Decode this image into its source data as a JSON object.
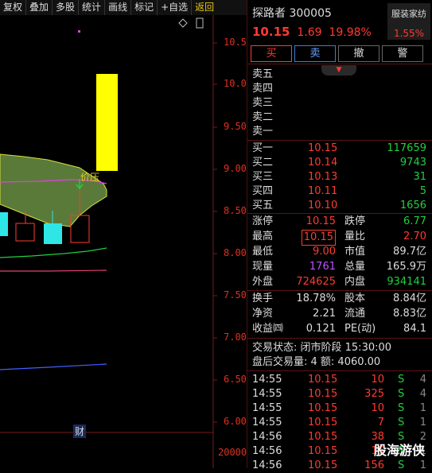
{
  "toolbar": {
    "items": [
      "复权",
      "叠加",
      "多股",
      "统计",
      "画线",
      "标记",
      "+自选",
      "返回"
    ]
  },
  "chart": {
    "price_ticks": [
      "10.50",
      "10.00",
      "9.50",
      "9.00",
      "8.50",
      "8.00",
      "7.50",
      "7.00",
      "6.50",
      "6.00"
    ],
    "volume_tick": "20000",
    "annotation_pressure": "价压",
    "annotation_finance": "财",
    "colors": {
      "up": "#ff3b30",
      "down": "#2ee6e6",
      "yellow": "#ffff00",
      "cloud": "#5a7a3a"
    }
  },
  "quote": {
    "name_code": "探路者 300005",
    "price": "10.15",
    "change": "1.69",
    "change_pct": "19.98%",
    "sector_name": "服装家纺",
    "sector_pct": "1.55%",
    "buttons": {
      "buy": "买",
      "sell": "卖",
      "cancel": "撤",
      "alert": "警"
    },
    "asks": [
      "卖五",
      "卖四",
      "卖三",
      "卖二",
      "卖一"
    ],
    "bids": [
      {
        "label": "买一",
        "price": "10.15",
        "vol": "117659"
      },
      {
        "label": "买二",
        "price": "10.14",
        "vol": "9743"
      },
      {
        "label": "买三",
        "price": "10.13",
        "vol": "31"
      },
      {
        "label": "买四",
        "price": "10.11",
        "vol": "5"
      },
      {
        "label": "买五",
        "price": "10.10",
        "vol": "1656"
      }
    ],
    "stats1": [
      {
        "l1": "涨停",
        "v1": "10.15",
        "l2": "跌停",
        "v2": "6.77"
      },
      {
        "l1": "最高",
        "v1": "10.15",
        "l2": "量比",
        "v2": "2.70"
      },
      {
        "l1": "最低",
        "v1": "9.00",
        "l2": "市值",
        "v2": "89.7亿"
      },
      {
        "l1": "现量",
        "v1": "1761",
        "l2": "总量",
        "v2": "165.9万"
      },
      {
        "l1": "外盘",
        "v1": "724625",
        "l2": "内盘",
        "v2": "934141"
      }
    ],
    "stats2": [
      {
        "l1": "换手",
        "v1": "18.78%",
        "l2": "股本",
        "v2": "8.84亿"
      },
      {
        "l1": "净资",
        "v1": "2.21",
        "l2": "流通",
        "v2": "8.83亿"
      },
      {
        "l1": "收益㈣",
        "v1": "0.121",
        "l2": "PE(动)",
        "v2": "84.1"
      }
    ],
    "status_line": "交易状态: 闭市阶段 15:30:00",
    "after_hours": "盘后交易量: 4  额: 4060.00",
    "ticks": [
      {
        "time": "14:55",
        "price": "10.15",
        "vol": "10",
        "side": "S",
        "n": "4"
      },
      {
        "time": "14:55",
        "price": "10.15",
        "vol": "325",
        "side": "S",
        "n": "4"
      },
      {
        "time": "14:55",
        "price": "10.15",
        "vol": "10",
        "side": "S",
        "n": "1"
      },
      {
        "time": "14:55",
        "price": "10.15",
        "vol": "7",
        "side": "S",
        "n": "1"
      },
      {
        "time": "14:56",
        "price": "10.15",
        "vol": "38",
        "side": "S",
        "n": "2"
      },
      {
        "time": "14:56",
        "price": "10.15",
        "vol": "15",
        "side": "S",
        "n": "1"
      },
      {
        "time": "14:56",
        "price": "10.15",
        "vol": "156",
        "side": "S",
        "n": "1"
      }
    ],
    "watermark": "股海游侠"
  }
}
